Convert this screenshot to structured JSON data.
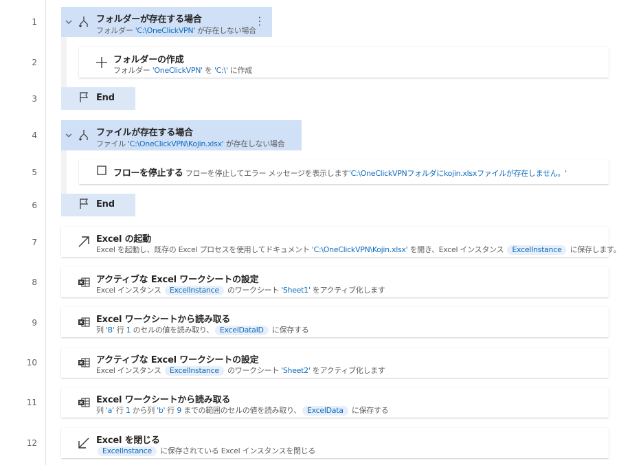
{
  "line_numbers": [
    "1",
    "2",
    "3",
    "4",
    "5",
    "6",
    "7",
    "8",
    "9",
    "10",
    "11",
    "12"
  ],
  "steps": {
    "s1": {
      "title": "フォルダーが存在する場合",
      "p1": "フォルダー ",
      "v1": "'C:\\OneClickVPN'",
      "p2": " が存在しない場合"
    },
    "s2": {
      "title": "フォルダーの作成",
      "p1": "フォルダー ",
      "v1": "'OneClickVPN'",
      "p2": " を ",
      "v2": "'C:\\'",
      "p3": " に作成"
    },
    "s3": {
      "title": "End"
    },
    "s4": {
      "title": "ファイルが存在する場合",
      "p1": "ファイル ",
      "v1": "'C:\\OneClickVPN\\Kojin.xlsx'",
      "p2": " が存在しない場合"
    },
    "s5": {
      "title": "フローを停止する",
      "p1": "フローを停止してエラー メッセージを表示します",
      "v1": "'C:\\OneClickVPNフォルダにkojin.xlsxファイルが存在しません。'"
    },
    "s6": {
      "title": "End"
    },
    "s7": {
      "title": "Excel の起動",
      "p1": "Excel を起動し、既存の Excel プロセスを使用してドキュメント ",
      "v1": "'C:\\OneClickVPN\\Kojin.xlsx'",
      "p2": " を開き、Excel インスタンス ",
      "pill1": "ExcelInstance",
      "p3": " に保存します。"
    },
    "s8": {
      "title": "アクティブな Excel ワークシートの設定",
      "p1": "Excel インスタンス ",
      "pill1": "ExcelInstance",
      "p2": " のワークシート ",
      "v1": "'Sheet1'",
      "p3": " をアクティブ化します"
    },
    "s9": {
      "title": "Excel ワークシートから読み取る",
      "p1": "列 ",
      "v1": "'B'",
      "p2": " 行 ",
      "v2": "1",
      "p3": " のセルの値を読み取り、",
      "pill1": "ExcelDataID",
      "p4": " に保存する"
    },
    "s10": {
      "title": "アクティブな Excel ワークシートの設定",
      "p1": "Excel インスタンス ",
      "pill1": "ExcelInstance",
      "p2": " のワークシート ",
      "v1": "'Sheet2'",
      "p3": " をアクティブ化します"
    },
    "s11": {
      "title": "Excel ワークシートから読み取る",
      "p1": "列 ",
      "v1": "'a'",
      "p2": " 行 ",
      "v2": "1",
      "p3": " から列 ",
      "v3": "'b'",
      "p4": " 行 ",
      "v4": "9",
      "p5": " までの範囲のセルの値を読み取り、",
      "pill1": "ExcelData",
      "p6": " に保存する"
    },
    "s12": {
      "title": "Excel を閉じる",
      "pill1": "ExcelInstance",
      "p1": " に保存されている Excel インスタンスを閉じる"
    }
  },
  "icons": {
    "condition": "condition-branch-icon",
    "add": "plus-icon",
    "end": "flag-icon",
    "stop": "stop-square-icon",
    "launch": "arrow-up-right-icon",
    "excel": "excel-sheet-icon",
    "close": "arrow-down-left-icon",
    "chevron": "chevron-down-icon",
    "more": "more-options-icon"
  },
  "colors": {
    "selected_bg": "#cfe0f7",
    "string_value": "#0f6cbd",
    "pill_bg": "#e6effa"
  }
}
